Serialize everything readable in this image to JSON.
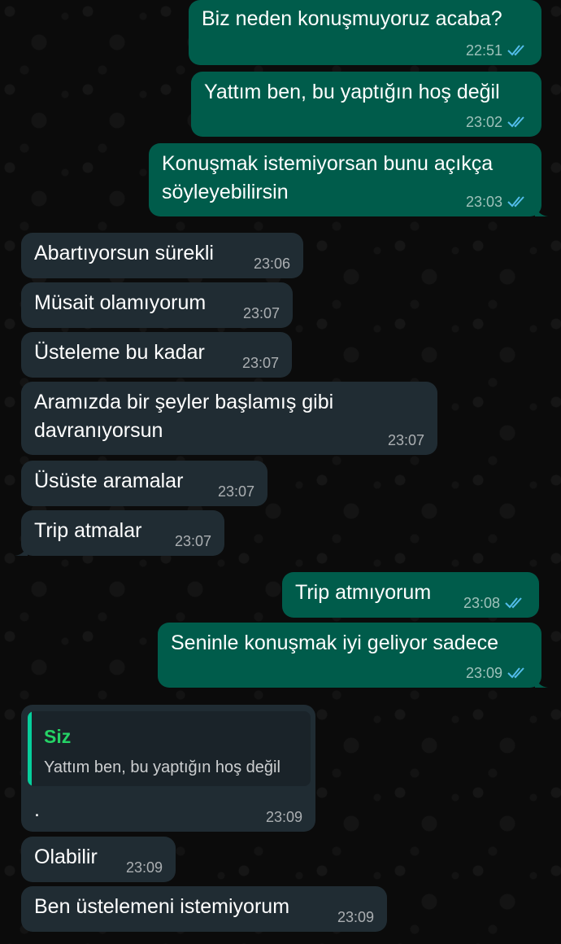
{
  "messages": [
    {
      "text": "Biz neden konuşmuyoruz acaba?",
      "time": "22:51"
    },
    {
      "text": "Yattım ben, bu yaptığın hoş değil",
      "time": "23:02"
    },
    {
      "text": "Konuşmak istemiyorsan bunu açıkça\nsöyleyebilirsin",
      "time": "23:03"
    },
    {
      "text": "Abartıyorsun sürekli",
      "time": "23:06"
    },
    {
      "text": "Müsait olamıyorum",
      "time": "23:07"
    },
    {
      "text": "Üsteleme bu kadar",
      "time": "23:07"
    },
    {
      "text": "Aramızda bir şeyler başlamış gibi\ndavranıyorsun",
      "time": "23:07"
    },
    {
      "text": "Üsüste aramalar",
      "time": "23:07"
    },
    {
      "text": "Trip atmalar",
      "time": "23:07"
    },
    {
      "text": "Trip atmıyorum",
      "time": "23:08"
    },
    {
      "text": "Seninle konuşmak iyi geliyor sadece",
      "time": "23:09"
    },
    {
      "text": ".",
      "time": "23:09",
      "reply_to": {
        "author": "Siz",
        "text": "Yattım ben, bu yaptığın hoş değil"
      }
    },
    {
      "text": "Olabilir",
      "time": "23:09"
    },
    {
      "text": "Ben üstelemeni istemiyorum",
      "time": "23:09"
    }
  ]
}
